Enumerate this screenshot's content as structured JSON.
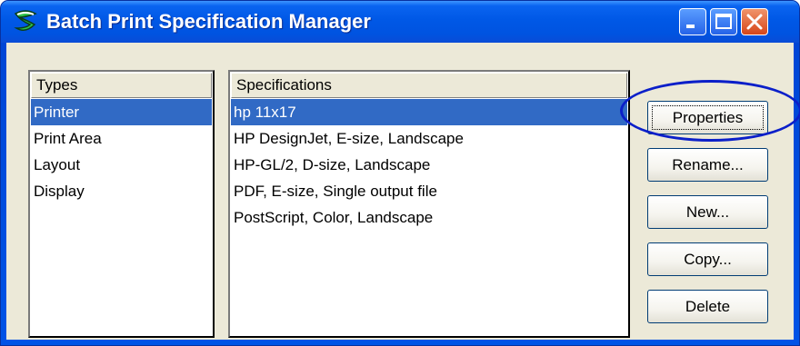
{
  "window": {
    "title": "Batch Print Specification Manager"
  },
  "types": {
    "header": "Types",
    "items": [
      "Printer",
      "Print Area",
      "Layout",
      "Display"
    ],
    "selected_index": 0
  },
  "specifications": {
    "header": "Specifications",
    "items": [
      "hp 11x17",
      "HP DesignJet, E-size, Landscape",
      "HP-GL/2, D-size, Landscape",
      "PDF, E-size, Single output file",
      "PostScript, Color, Landscape"
    ],
    "selected_index": 0
  },
  "buttons": {
    "properties": "Properties",
    "rename": "Rename...",
    "new": "New...",
    "copy": "Copy...",
    "delete": "Delete"
  },
  "colors": {
    "titlebar": "#0058e6",
    "selection": "#316ac5",
    "highlight_ring": "#0b1fc9"
  }
}
